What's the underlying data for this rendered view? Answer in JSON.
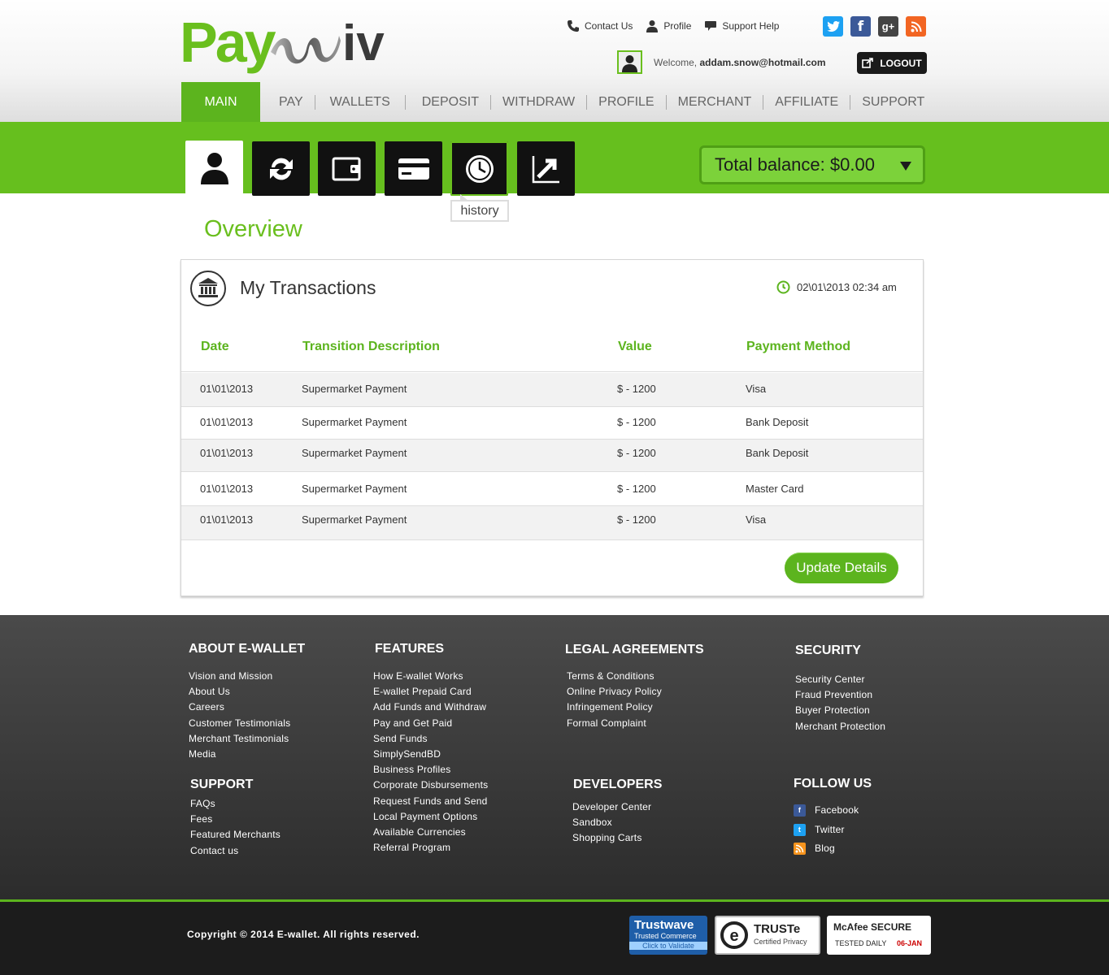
{
  "brand": {
    "logo_left": "Pay",
    "logo_right": "iv"
  },
  "top_links": [
    {
      "label": "Contact Us",
      "icon": "phone-icon"
    },
    {
      "label": "Profile",
      "icon": "user-icon"
    },
    {
      "label": "Support Help",
      "icon": "chat-bubble-icon"
    }
  ],
  "social": [
    {
      "name": "twitter-icon",
      "glyph": "t",
      "color": "#1da1f2"
    },
    {
      "name": "facebook-icon",
      "glyph": "f",
      "color": "#3b5998"
    },
    {
      "name": "google-plus-icon",
      "glyph": "g+",
      "color": "#444444"
    },
    {
      "name": "rss-icon",
      "glyph": "rss",
      "color": "#f26522"
    }
  ],
  "welcome": {
    "prefix": "Welcome,",
    "email": "addam.snow@hotmail.com"
  },
  "logout_label": "LOGOUT",
  "nav": [
    "MAIN",
    "PAY",
    "WALLETS",
    "DEPOSIT",
    "WITHDRAW",
    "PROFILE",
    "MERCHANT",
    "AFFILIATE",
    "SUPPORT"
  ],
  "toolbar": [
    "profile-icon",
    "exchange-icon",
    "wallet-icon",
    "card-icon",
    "history-icon",
    "stats-icon"
  ],
  "tooltip": "history",
  "balance": "Total balance: $0.00",
  "overview_title": "Overview",
  "transactions": {
    "title": "My Transactions",
    "timestamp": "02\\01\\2013 02:34 am",
    "columns": [
      "Date",
      "Transition Description",
      "Value",
      "Payment Method"
    ],
    "rows": [
      [
        "01\\01\\2013",
        "Supermarket Payment",
        "$ - 1200",
        "Visa"
      ],
      [
        "01\\01\\2013",
        "Supermarket Payment",
        "$ - 1200",
        "Bank Deposit"
      ],
      [
        "01\\01\\2013",
        "Supermarket Payment",
        "$ - 1200",
        "Bank Deposit"
      ],
      [
        "01\\01\\2013",
        "Supermarket Payment",
        "$ - 1200",
        "Master Card"
      ],
      [
        "01\\01\\2013",
        "Supermarket Payment",
        "$ - 1200",
        "Visa"
      ]
    ],
    "update_label": "Update Details"
  },
  "footer": {
    "about": {
      "title": "ABOUT E-WALLET",
      "items": [
        "Vision and Mission",
        "About Us",
        "Careers",
        "Customer Testimonials",
        "Merchant Testimonials",
        "Media"
      ]
    },
    "support": {
      "title": "SUPPORT",
      "items": [
        "FAQs",
        "Fees",
        "Featured Merchants",
        "Contact us"
      ]
    },
    "features": {
      "title": "FEATURES",
      "items": [
        "How E-wallet Works",
        "E-wallet Prepaid Card",
        "Add Funds and Withdraw",
        "Pay and Get Paid",
        "Send Funds",
        "SimplySendBD",
        "Business Profiles",
        "Corporate Disbursements",
        "Request Funds and Send",
        "Local Payment Options",
        "Available Currencies",
        "Referral Program"
      ]
    },
    "legal": {
      "title": "LEGAL AGREEMENTS",
      "items": [
        "Terms & Conditions",
        "Online Privacy Policy",
        "Infringement Policy",
        "Formal Complaint"
      ]
    },
    "developers": {
      "title": "DEVELOPERS",
      "items": [
        "Developer Center",
        "Sandbox",
        "Shopping Carts"
      ]
    },
    "security": {
      "title": "SECURITY",
      "items": [
        "Security Center",
        "Fraud Prevention",
        "Buyer Protection",
        "Merchant Protection"
      ]
    },
    "follow": {
      "title": "FOLLOW US",
      "items": [
        "Facebook",
        "Twitter",
        "Blog"
      ]
    },
    "copyright": "Copyright © 2014 E-wallet. All rights reserved.",
    "badges": {
      "trustwave": {
        "name": "Trustwave",
        "line1": "Trusted Commerce",
        "line2": "Click to Validate"
      },
      "truste": {
        "name": "TRUSTe",
        "line1": "Certified Privacy"
      },
      "mcafee": {
        "name": "McAfee SECURE",
        "line1": "TESTED DAILY",
        "date": "06-JAN"
      }
    }
  }
}
